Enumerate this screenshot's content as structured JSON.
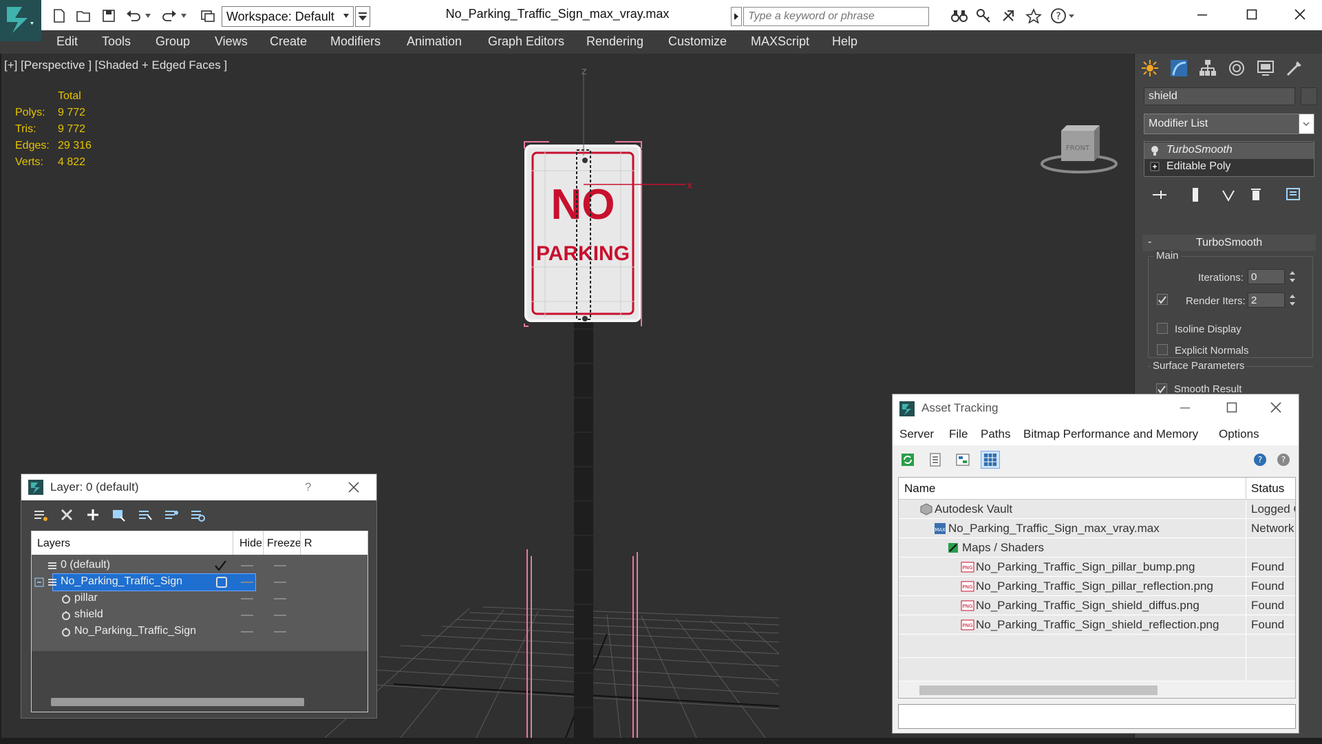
{
  "titlebar": {
    "workspace_label": "Workspace: Default",
    "window_title": "No_Parking_Traffic_Sign_max_vray.max",
    "search_placeholder": "Type a keyword or phrase"
  },
  "menu": {
    "items": [
      "Edit",
      "Tools",
      "Group",
      "Views",
      "Create",
      "Modifiers",
      "Animation",
      "Graph Editors",
      "Rendering",
      "Customize",
      "MAXScript",
      "Help"
    ]
  },
  "viewport": {
    "label": "[+] [Perspective ] [Shaded + Edged Faces ]",
    "stats": {
      "header": "Total",
      "rows": [
        {
          "label": "Polys:",
          "value": "9 772"
        },
        {
          "label": "Tris:",
          "value": "9 772"
        },
        {
          "label": "Edges:",
          "value": "29 316"
        },
        {
          "label": "Verts:",
          "value": "4 822"
        }
      ]
    },
    "sign_line1": "NO",
    "sign_line2": "PARKING",
    "axis_z": "z",
    "axis_x": "x",
    "viewcube_label": "FRONT"
  },
  "command_panel": {
    "object_name": "shield",
    "modifier_list": "Modifier List",
    "stack": [
      "TurboSmooth",
      "Editable Poly"
    ],
    "rollout_title": "TurboSmooth",
    "main_group": "Main",
    "iterations_label": "Iterations:",
    "iterations_value": "0",
    "render_iters_label": "Render Iters:",
    "render_iters_value": "2",
    "isoline_label": "Isoline Display",
    "explicit_label": "Explicit Normals",
    "surface_group": "Surface Parameters",
    "smooth_result_label": "Smooth Result"
  },
  "layer_dialog": {
    "title": "Layer: 0 (default)",
    "help": "?",
    "columns": {
      "layers": "Layers",
      "hide": "Hide",
      "freeze": "Freeze",
      "render": "R"
    },
    "rows": [
      {
        "name": "0 (default)"
      },
      {
        "name": "No_Parking_Traffic_Sign"
      },
      {
        "name": "pillar"
      },
      {
        "name": "shield"
      },
      {
        "name": "No_Parking_Traffic_Sign"
      }
    ]
  },
  "asset_dialog": {
    "title": "Asset Tracking",
    "menu": [
      "Server",
      "File",
      "Paths",
      "Bitmap Performance and Memory",
      "Options"
    ],
    "columns": {
      "name": "Name",
      "status": "Status"
    },
    "rows": [
      {
        "name": "Autodesk Vault",
        "status": "Logged C"
      },
      {
        "name": "No_Parking_Traffic_Sign_max_vray.max",
        "status": "Network"
      },
      {
        "name": "Maps / Shaders",
        "status": ""
      },
      {
        "name": "No_Parking_Traffic_Sign_pillar_bump.png",
        "status": "Found"
      },
      {
        "name": "No_Parking_Traffic_Sign_pillar_reflection.png",
        "status": "Found"
      },
      {
        "name": "No_Parking_Traffic_Sign_shield_diffus.png",
        "status": "Found"
      },
      {
        "name": "No_Parking_Traffic_Sign_shield_reflection.png",
        "status": "Found"
      }
    ]
  },
  "colors": {
    "accent_blue": "#1e6fd0",
    "stats_yellow": "#e6c400",
    "sign_red": "#c8102e",
    "selection_pink": "#e8799a"
  }
}
